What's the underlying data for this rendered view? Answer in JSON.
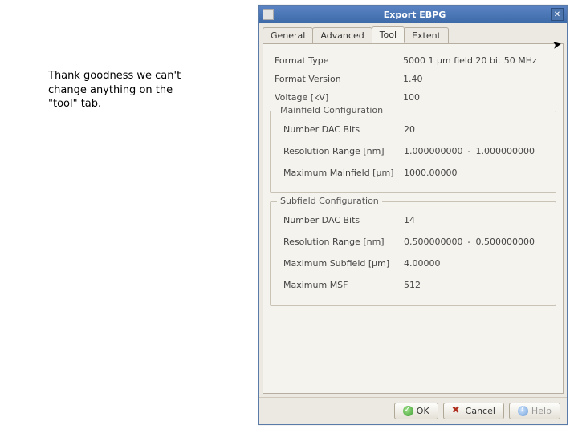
{
  "annotation": "Thank goodness we can't change anything on the \"tool\" tab.",
  "window": {
    "title": "Export EBPG"
  },
  "tabs": [
    "General",
    "Advanced",
    "Tool",
    "Extent"
  ],
  "activeTab": 2,
  "general": {
    "formatTypeLabel": "Format Type",
    "formatTypeValue": "5000 1 μm field 20 bit 50 MHz",
    "formatVersionLabel": "Format Version",
    "formatVersionValue": "1.40",
    "voltageLabel": "Voltage [kV]",
    "voltageValue": "100"
  },
  "mainfield": {
    "legend": "Mainfield Configuration",
    "dacLabel": "Number DAC Bits",
    "dacValue": "20",
    "resLabel": "Resolution Range [nm]",
    "resLow": "1.000000000",
    "resSep": "-",
    "resHigh": "1.000000000",
    "maxLabel": "Maximum Mainfield [μm]",
    "maxValue": "1000.00000"
  },
  "subfield": {
    "legend": "Subfield Configuration",
    "dacLabel": "Number DAC Bits",
    "dacValue": "14",
    "resLabel": "Resolution Range [nm]",
    "resLow": "0.500000000",
    "resSep": "-",
    "resHigh": "0.500000000",
    "maxSubLabel": "Maximum Subfield [μm]",
    "maxSubValue": "4.00000",
    "maxMsfLabel": "Maximum MSF",
    "maxMsfValue": "512"
  },
  "buttons": {
    "ok": "OK",
    "cancel": "Cancel",
    "help": "Help"
  }
}
